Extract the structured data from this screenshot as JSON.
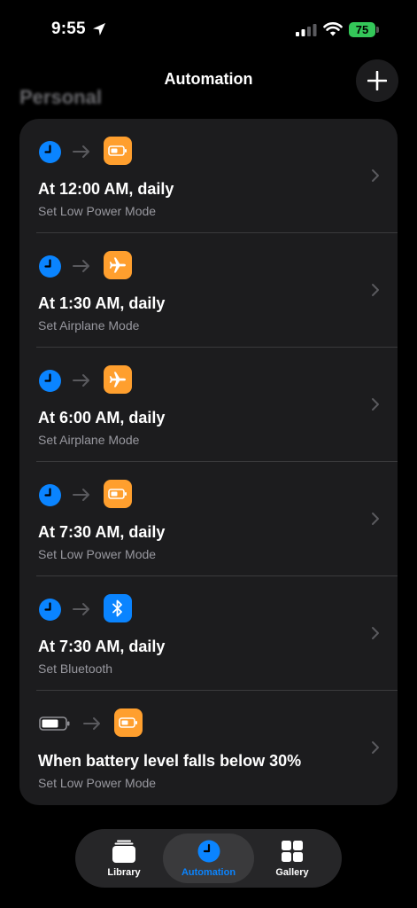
{
  "status_bar": {
    "time": "9:55",
    "battery_level": "75"
  },
  "header": {
    "title": "Automation",
    "section": "Personal"
  },
  "automations": [
    {
      "trigger_icon": "clock-icon",
      "action_icon": "low-power-battery-icon",
      "title": "At 12:00 AM, daily",
      "subtitle": "Set Low Power Mode"
    },
    {
      "trigger_icon": "clock-icon",
      "action_icon": "airplane-icon",
      "title": "At 1:30 AM, daily",
      "subtitle": "Set Airplane Mode"
    },
    {
      "trigger_icon": "clock-icon",
      "action_icon": "airplane-icon",
      "title": "At 6:00 AM, daily",
      "subtitle": "Set Airplane Mode"
    },
    {
      "trigger_icon": "clock-icon",
      "action_icon": "low-power-battery-icon",
      "title": "At 7:30 AM, daily",
      "subtitle": "Set Low Power Mode"
    },
    {
      "trigger_icon": "clock-icon",
      "action_icon": "bluetooth-icon",
      "title": "At 7:30 AM, daily",
      "subtitle": "Set Bluetooth"
    },
    {
      "trigger_icon": "battery-icon",
      "action_icon": "low-power-battery-icon",
      "title": "When battery level falls below 30%",
      "subtitle": "Set Low Power Mode"
    }
  ],
  "tabs": [
    {
      "label": "Library",
      "icon": "library-stack-icon"
    },
    {
      "label": "Automation",
      "icon": "clock-icon",
      "active": true
    },
    {
      "label": "Gallery",
      "icon": "gallery-grid-icon"
    }
  ],
  "colors": {
    "accent_blue": "#0a84ff",
    "action_orange": "#ff9f2e",
    "bluetooth_blue": "#0a84ff",
    "battery_green": "#34c759",
    "card_background": "#1c1c1e"
  }
}
